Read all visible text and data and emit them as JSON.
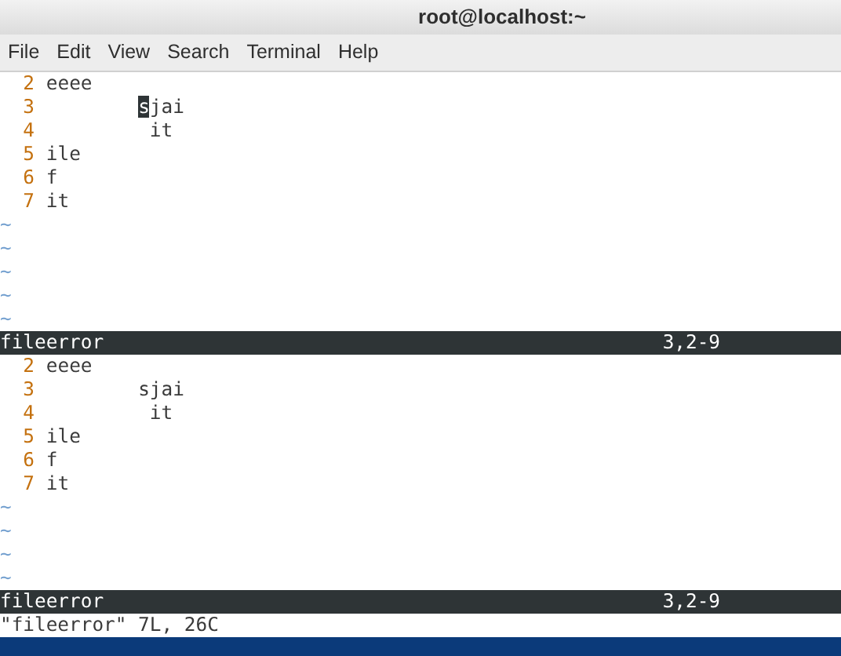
{
  "window": {
    "title": "root@localhost:~"
  },
  "menu": [
    "File",
    "Edit",
    "View",
    "Search",
    "Terminal",
    "Help"
  ],
  "panes": [
    {
      "lines": [
        {
          "kind": "plain",
          "number": "2",
          "text": "eeee"
        },
        {
          "kind": "cursor",
          "number": "3",
          "text": "        sjai"
        },
        {
          "kind": "plain",
          "number": "4",
          "text": "         it"
        },
        {
          "kind": "plain",
          "number": "5",
          "text": "ile"
        },
        {
          "kind": "plain",
          "number": "6",
          "text": "f"
        },
        {
          "kind": "plain",
          "number": "7",
          "text": "it"
        }
      ],
      "filler": [
        "~",
        "~",
        "~",
        "~",
        "~"
      ],
      "status": {
        "file": "fileerror",
        "position": "3,2-9"
      }
    },
    {
      "lines": [
        {
          "kind": "plain",
          "number": "2",
          "text": "eeee"
        },
        {
          "kind": "plain",
          "number": "3",
          "text": "        sjai"
        },
        {
          "kind": "plain",
          "number": "4",
          "text": "         it"
        },
        {
          "kind": "plain",
          "number": "5",
          "text": "ile"
        },
        {
          "kind": "plain",
          "number": "6",
          "text": "f"
        },
        {
          "kind": "plain",
          "number": "7",
          "text": "it"
        }
      ],
      "filler": [
        "~",
        "~",
        "~",
        "~"
      ],
      "status": {
        "file": "fileerror",
        "position": "3,2-9"
      }
    }
  ],
  "command_line": "\"fileerror\" 7L, 26C"
}
